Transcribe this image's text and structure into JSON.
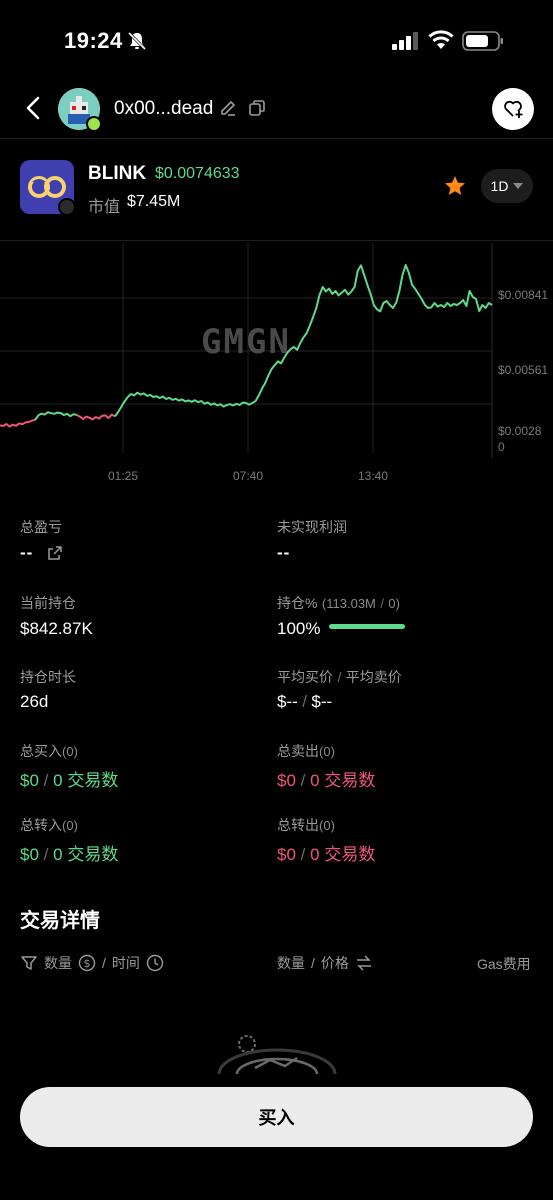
{
  "status": {
    "time": "19:24"
  },
  "header": {
    "wallet_address": "0x00...dead"
  },
  "token": {
    "symbol": "BLINK",
    "price": "$0.0074633",
    "mcap_label": "市值",
    "mcap_value": "$7.45M",
    "timeframe": "1D"
  },
  "chart_data": {
    "type": "line",
    "watermark": "GMGN",
    "x_ticks": [
      "01:25",
      "07:40",
      "13:40"
    ],
    "y_ticks": [
      "$0.00841",
      "$0.00561",
      "$0.0028",
      "0"
    ],
    "colors": {
      "up": "#5fd98a",
      "down": "#f0567a",
      "grid": "#222222"
    },
    "series": [
      {
        "color": "#f0567a",
        "values": [
          0.00188,
          0.00185,
          0.00195,
          0.00182,
          0.00192,
          0.00186,
          0.00198,
          0.00194,
          0.00203,
          0.00205,
          0.00212,
          0.00215
        ]
      },
      {
        "color": "#5fd98a",
        "values": [
          0.00215,
          0.00238,
          0.00247,
          0.00242,
          0.00254,
          0.00249,
          0.00246,
          0.00252,
          0.0025,
          0.0024,
          0.00246,
          0.00234,
          0.00244,
          0.0024
        ]
      },
      {
        "color": "#f0567a",
        "values": [
          0.0024,
          0.00232,
          0.0022,
          0.00232,
          0.00226,
          0.00218,
          0.0023,
          0.00222,
          0.00236,
          0.00238,
          0.00225,
          0.00242,
          0.00233
        ]
      },
      {
        "color": "#5fd98a",
        "values": [
          0.00233,
          0.00255,
          0.00282,
          0.00308,
          0.0033,
          0.00345,
          0.00338,
          0.00352,
          0.00342,
          0.00348,
          0.00336,
          0.0034,
          0.0033,
          0.00334,
          0.00325,
          0.00332,
          0.0032,
          0.00326,
          0.00316,
          0.00321,
          0.00312,
          0.00318,
          0.00308,
          0.00313,
          0.00306,
          0.00314,
          0.00304,
          0.0031,
          0.00296,
          0.00303,
          0.00291,
          0.00298,
          0.00288,
          0.00294,
          0.00282,
          0.0029,
          0.00294,
          0.00288,
          0.00296,
          0.0029,
          0.00302,
          0.003,
          0.00292,
          0.003,
          0.0031,
          0.00338,
          0.00372,
          0.004,
          0.00438,
          0.0047,
          0.0049,
          0.00508,
          0.00498,
          0.00528,
          0.00552,
          0.0057,
          0.0058,
          0.00566,
          0.006,
          0.00628,
          0.0065,
          0.00688,
          0.0073,
          0.00775,
          0.0084,
          0.0088,
          0.00858,
          0.00872,
          0.00845,
          0.0086,
          0.00838,
          0.00852,
          0.00866,
          0.00842,
          0.00858,
          0.0088,
          0.00962,
          0.00988,
          0.0094,
          0.0089,
          0.00845,
          0.0079,
          0.00768,
          0.00758,
          0.008,
          0.0081,
          0.0079,
          0.00775,
          0.00802,
          0.0086,
          0.0094,
          0.0099,
          0.0095,
          0.0089,
          0.0087,
          0.00845,
          0.0082,
          0.0079,
          0.00775,
          0.00778,
          0.008,
          0.00782,
          0.0079,
          0.0078,
          0.008,
          0.00785,
          0.00795,
          0.0079,
          0.008,
          0.00815,
          0.00785,
          0.0086,
          0.0083,
          0.0082,
          0.0076,
          0.0079,
          0.00775,
          0.008,
          0.0079
        ]
      }
    ]
  },
  "stats": {
    "total_pnl_label": "总盈亏",
    "total_pnl_value": "--",
    "unrealized_label": "未实现利润",
    "unrealized_value": "--",
    "holding_label": "当前持仓",
    "holding_value": "$842.87K",
    "holding_pct_label": "持仓%",
    "holding_pct_amount": "113.03M",
    "holding_pct_total": "0",
    "holding_pct_value": "100%",
    "holding_pct_fill": 1.0,
    "duration_label": "持仓时长",
    "duration_value": "26d",
    "avg_buy_label": "平均买价",
    "avg_sell_label": "平均卖价",
    "avg_buy_value": "$--",
    "avg_sell_value": "$--",
    "total_buy_label": "总买入",
    "total_buy_count": "0",
    "total_buy_amount": "$0",
    "total_buy_tx": "0",
    "total_sell_label": "总卖出",
    "total_sell_count": "0",
    "total_sell_amount": "$0",
    "total_sell_tx": "0",
    "transfer_in_label": "总转入",
    "transfer_in_count": "0",
    "transfer_in_amount": "$0",
    "transfer_in_tx": "0",
    "transfer_out_label": "总转出",
    "transfer_out_count": "0",
    "transfer_out_amount": "$0",
    "transfer_out_tx": "0",
    "tx_unit": "交易数"
  },
  "trades": {
    "title": "交易详情",
    "col_amount": "数量",
    "col_time": "时间",
    "col_qty": "数量",
    "col_price": "价格",
    "col_gas": "Gas费用"
  },
  "actions": {
    "buy_label": "买入"
  }
}
